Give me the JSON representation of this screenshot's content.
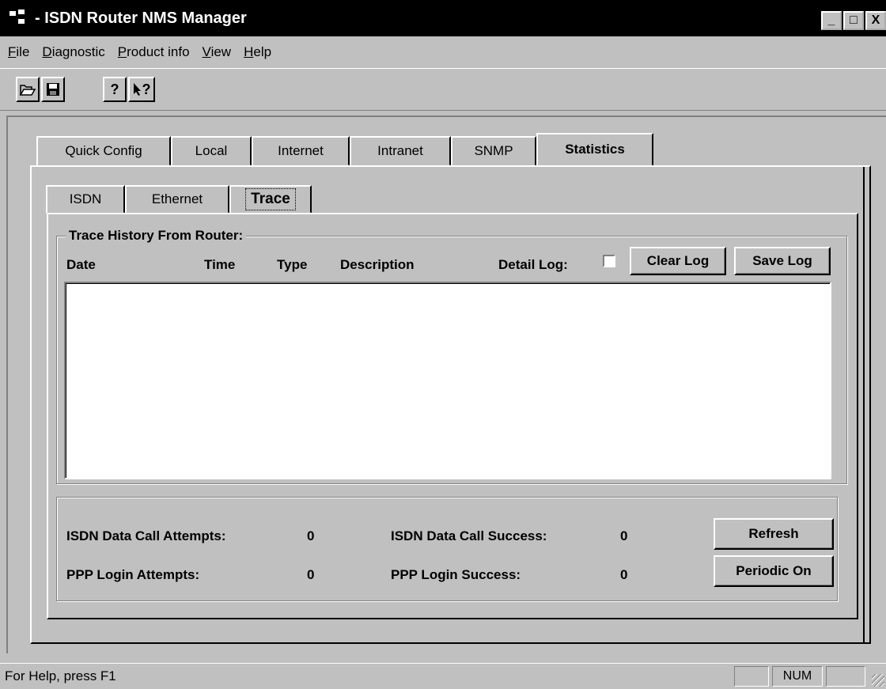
{
  "window": {
    "title": " - ISDN Router NMS Manager",
    "controls": [
      "_",
      "□",
      "X"
    ]
  },
  "menu": [
    {
      "mnemonic": "F",
      "rest": "ile"
    },
    {
      "mnemonic": "D",
      "rest": "iagnostic"
    },
    {
      "mnemonic": "P",
      "rest": "roduct info"
    },
    {
      "mnemonic": "V",
      "rest": "iew"
    },
    {
      "mnemonic": "H",
      "rest": "elp"
    }
  ],
  "toolbar": {
    "icons": [
      "open-icon",
      "save-icon",
      "help-icon",
      "context-help-icon"
    ],
    "help_glyph": "?",
    "context_glyph": "?"
  },
  "main_tabs": [
    "Quick Config",
    "Local",
    "Internet",
    "Intranet",
    "SNMP",
    "Statistics"
  ],
  "main_tabs_active": "Statistics",
  "sub_tabs": [
    "ISDN",
    "Ethernet",
    "Trace"
  ],
  "sub_tabs_active": "Trace",
  "trace": {
    "group_title": "Trace History From Router:",
    "columns": [
      "Date",
      "Time",
      "Type",
      "Description"
    ],
    "detail_log_label": "Detail Log:",
    "detail_log_checked": false,
    "clear_log": "Clear Log",
    "save_log": "Save Log",
    "rows": []
  },
  "stats": {
    "isdn_attempts_label": "ISDN Data Call Attempts:",
    "isdn_attempts_value": "0",
    "isdn_success_label": "ISDN Data Call Success:",
    "isdn_success_value": "0",
    "ppp_attempts_label": "PPP Login Attempts:",
    "ppp_attempts_value": "0",
    "ppp_success_label": "PPP Login Success:",
    "ppp_success_value": "0",
    "refresh": "Refresh",
    "periodic": "Periodic On"
  },
  "status": {
    "text": "For Help, press F1",
    "num": "NUM"
  }
}
